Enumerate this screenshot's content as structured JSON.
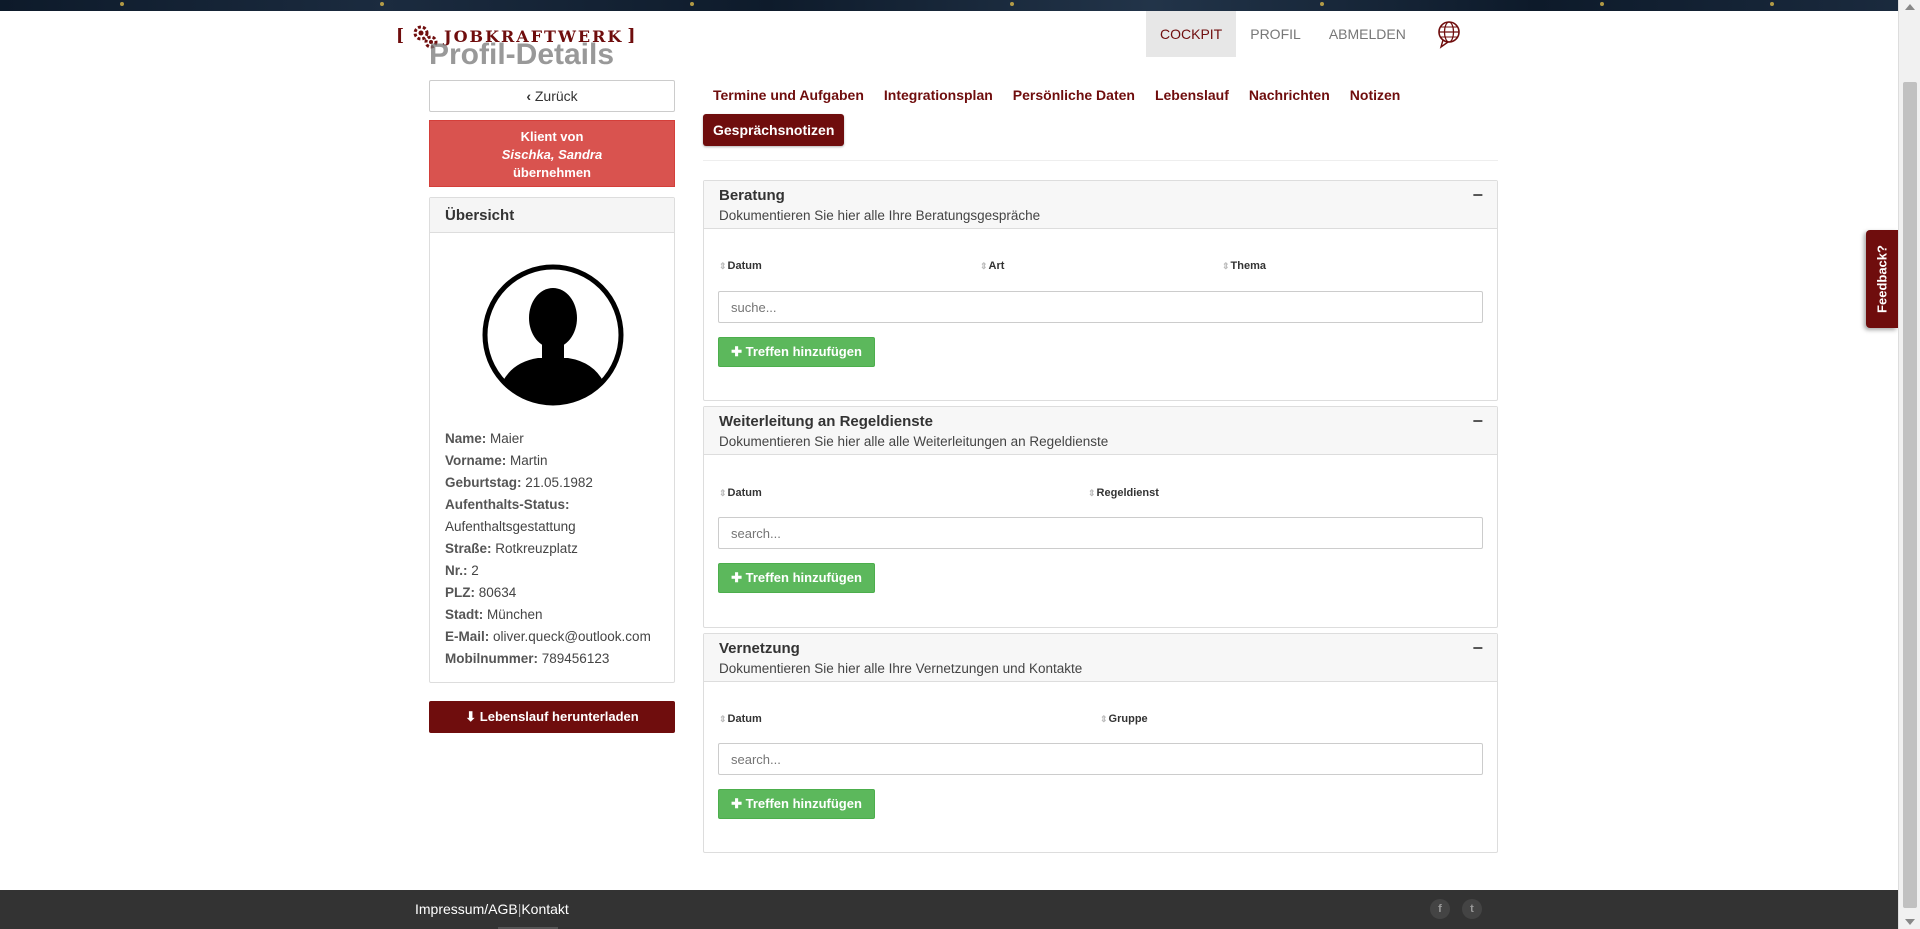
{
  "brand": {
    "name": "JobKraftwerk",
    "bracket_open": "[",
    "bracket_close": "]"
  },
  "page_title": "Profil-Details",
  "nav": {
    "cockpit": "COCKPIT",
    "profile": "PROFIL",
    "logout": "ABMELDEN"
  },
  "feedback": "Feedback?",
  "sidebar": {
    "back": "Zurück",
    "take_over": {
      "line1": "Klient von",
      "name": "Sischka, Sandra",
      "line3": "übernehmen"
    },
    "overview_title": "Übersicht",
    "fields": [
      {
        "label": "Name:",
        "value": "Maier"
      },
      {
        "label": "Vorname:",
        "value": "Martin"
      },
      {
        "label": "Geburtstag:",
        "value": "21.05.1982"
      },
      {
        "label": "Aufenthalts-Status:",
        "value": ""
      },
      {
        "label": "",
        "value": "Aufenthaltsgestattung"
      },
      {
        "label": "Straße:",
        "value": "Rotkreuzplatz"
      },
      {
        "label": "Nr.:",
        "value": "2"
      },
      {
        "label": "PLZ:",
        "value": "80634"
      },
      {
        "label": "Stadt:",
        "value": "München"
      },
      {
        "label": "E-Mail:",
        "value": "oliver.queck@outlook.com"
      },
      {
        "label": "Mobilnummer:",
        "value": "789456123"
      }
    ],
    "download": "Lebenslauf herunterladen"
  },
  "tabs": [
    "Termine und Aufgaben",
    "Integrationsplan",
    "Persönliche Daten",
    "Lebenslauf",
    "Nachrichten",
    "Notizen",
    "Gesprächsnotizen"
  ],
  "sections": [
    {
      "title": "Beratung",
      "desc": "Dokumentieren Sie hier alle Ihre Beratungsgespräche",
      "columns": [
        "Datum",
        "Art",
        "Thema"
      ],
      "search_placeholder": "suche...",
      "add": "Treffen hinzufügen"
    },
    {
      "title": "Weiterleitung an Regeldienste",
      "desc": "Dokumentieren Sie hier alle alle Weiterleitungen an Regeldienste",
      "columns": [
        "Datum",
        "Regeldienst"
      ],
      "search_placeholder": "search...",
      "add": "Treffen hinzufügen"
    },
    {
      "title": "Vernetzung",
      "desc": "Dokumentieren Sie hier alle Ihre Vernetzungen und Kontakte",
      "columns": [
        "Datum",
        "Gruppe"
      ],
      "search_placeholder": "search...",
      "add": "Treffen hinzufügen"
    }
  ],
  "footer": {
    "impressum": "Impressum/AGB",
    "kontakt": "Kontakt",
    "facebook": "f",
    "twitter": "t"
  },
  "colors": {
    "brand": "#6f0d0d",
    "danger": "#d9534f",
    "success": "#5cb85c",
    "footer": "#333333"
  }
}
